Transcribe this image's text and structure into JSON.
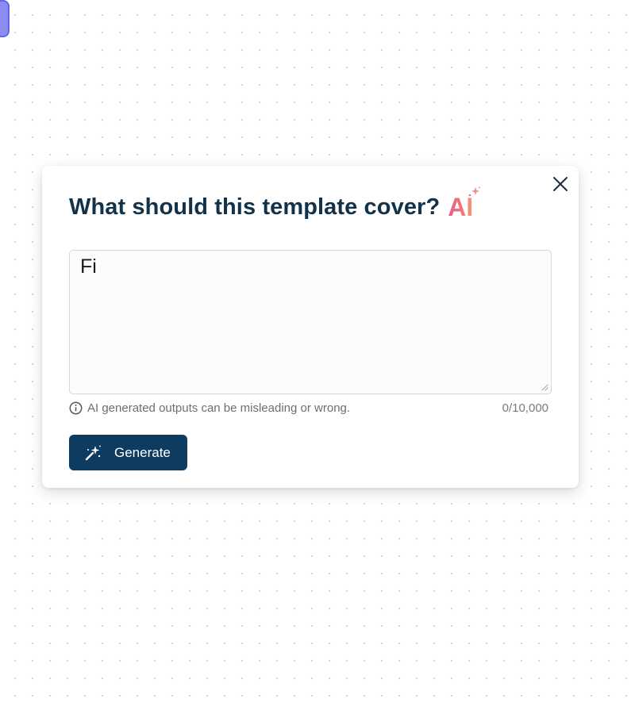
{
  "dialog": {
    "title": "What should this template cover?",
    "ai_badge": "AI",
    "close_icon": "close-icon",
    "prompt": {
      "value": "Fi",
      "placeholder": ""
    },
    "disclaimer": "AI generated outputs can be misleading or wrong.",
    "disclaimer_icon": "info-icon",
    "char_count": "0/10,000",
    "generate_label": "Generate",
    "generate_icon": "magic-wand-icon"
  },
  "colors": {
    "title": "#12324a",
    "primary_button": "#0e3c60",
    "ai_gradient_start": "#e85d8a",
    "ai_gradient_end": "#f39a76",
    "corner_handle": "#8a8cf0"
  }
}
